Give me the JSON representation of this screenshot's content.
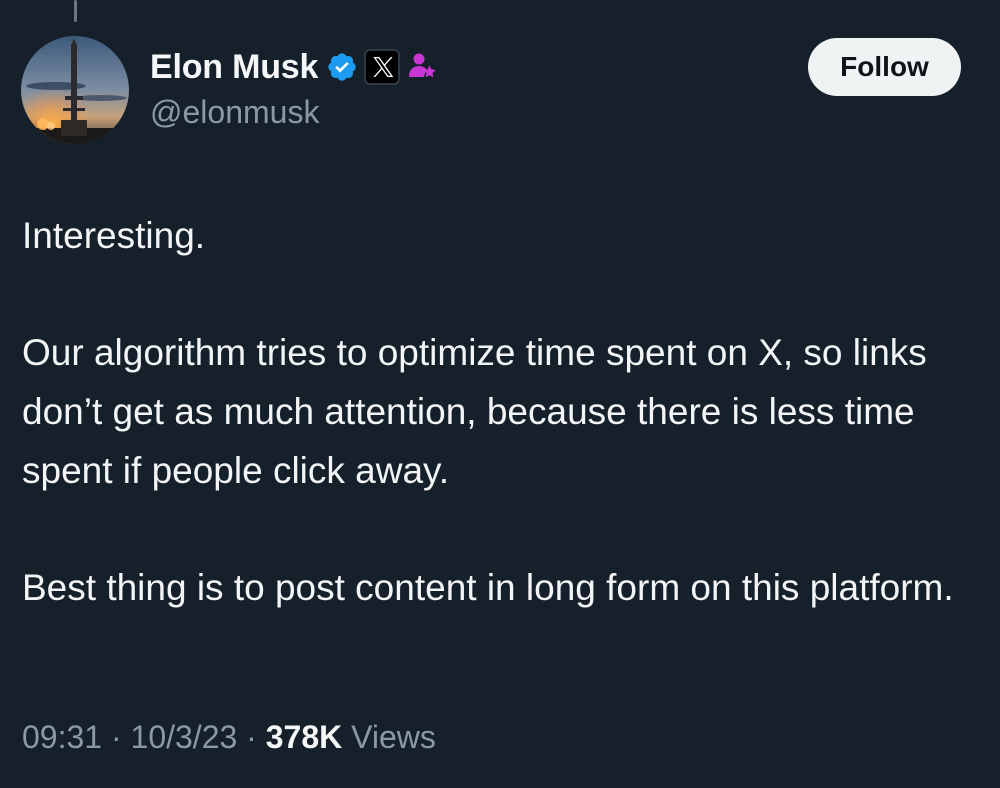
{
  "author": {
    "name": "Elon Musk",
    "handle": "@elonmusk",
    "verified_icon": "verified-badge-icon",
    "org_icon": "x-logo-icon",
    "affiliation_icon": "affiliate-person-icon",
    "avatar": "starship-launch-tower-at-dusk"
  },
  "follow_button": {
    "label": "Follow"
  },
  "tweet": {
    "paragraphs": [
      "Interesting.",
      "Our algorithm tries to optimize time spent on X, so links don’t get as much attention, because there is less time spent if people click away.",
      "Best thing is to post content in long form on this platform."
    ]
  },
  "meta": {
    "time": "09:31",
    "date": "10/3/23",
    "separator": "·",
    "views_count": "378K",
    "views_label": "Views"
  },
  "colors": {
    "background": "#16202b",
    "text": "#e7e9ea",
    "muted": "#8b98a5",
    "verified": "#1d9bf0",
    "affiliate": "#c935d6",
    "button_bg": "#eff3f4"
  }
}
